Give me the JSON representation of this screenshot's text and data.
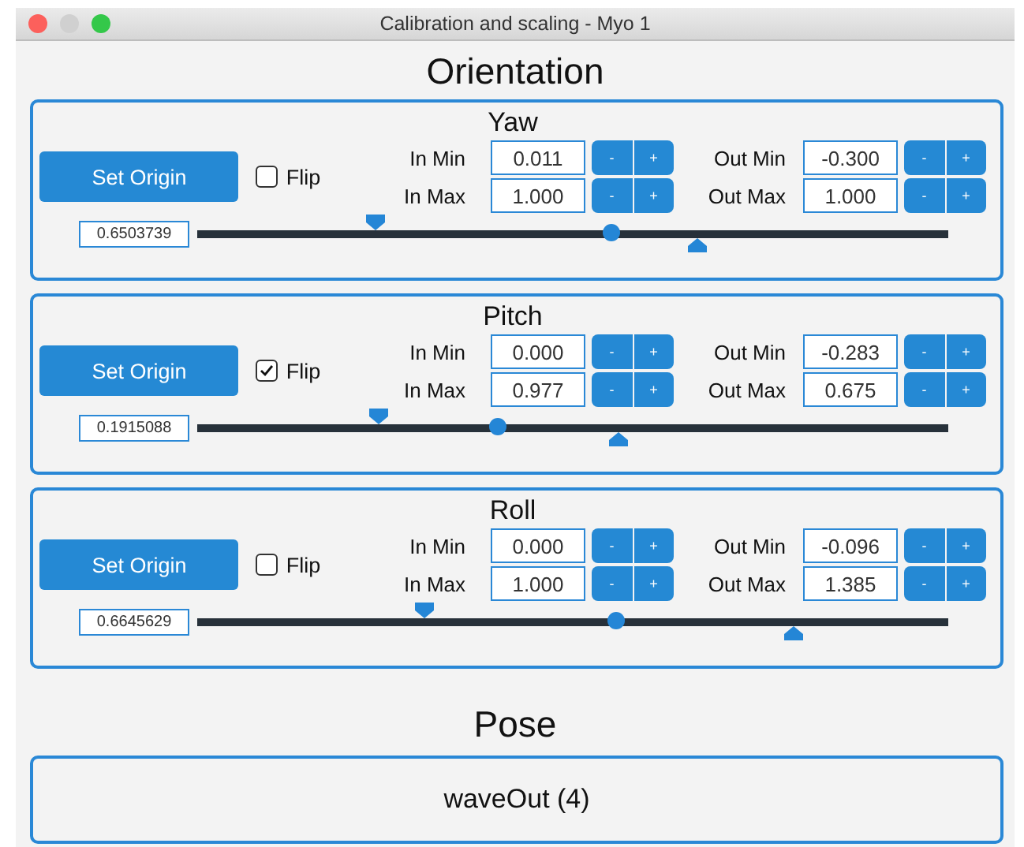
{
  "window": {
    "title": "Calibration and scaling - Myo 1"
  },
  "orientation": {
    "heading": "Orientation",
    "axes": [
      {
        "title": "Yaw",
        "button": "Set Origin",
        "flip": {
          "label": "Flip",
          "checked": false
        },
        "fields": [
          {
            "label": "In Min",
            "value": "0.011",
            "minus": "-",
            "plus": "+"
          },
          {
            "label": "Out Min",
            "value": "-0.300",
            "minus": "-",
            "plus": "+"
          },
          {
            "label": "In Max",
            "value": "1.000",
            "minus": "-",
            "plus": "+"
          },
          {
            "label": "Out Max",
            "value": "1.000",
            "minus": "-",
            "plus": "+"
          }
        ],
        "reading": "0.6503739",
        "markers": [
          {
            "kind": "low",
            "level": 0.238
          },
          {
            "kind": "value",
            "level": 0.55
          },
          {
            "kind": "high",
            "level": 0.665
          }
        ]
      },
      {
        "title": "Pitch",
        "button": "Set Origin",
        "flip": {
          "label": "Flip",
          "checked": true
        },
        "fields": [
          {
            "label": "In Min",
            "value": "0.000",
            "minus": "-",
            "plus": "+"
          },
          {
            "label": "Out Min",
            "value": "-0.283",
            "minus": "-",
            "plus": "+"
          },
          {
            "label": "In Max",
            "value": "0.977",
            "minus": "-",
            "plus": "+"
          },
          {
            "label": "Out Max",
            "value": "0.675",
            "minus": "-",
            "plus": "+"
          }
        ],
        "reading": "0.1915088",
        "markers": [
          {
            "kind": "low",
            "level": 0.242
          },
          {
            "kind": "value",
            "level": 0.4
          },
          {
            "kind": "high",
            "level": 0.56
          }
        ]
      },
      {
        "title": "Roll",
        "button": "Set Origin",
        "flip": {
          "label": "Flip",
          "checked": false
        },
        "fields": [
          {
            "label": "In Min",
            "value": "0.000",
            "minus": "-",
            "plus": "+"
          },
          {
            "label": "Out Min",
            "value": "-0.096",
            "minus": "-",
            "plus": "+"
          },
          {
            "label": "In Max",
            "value": "1.000",
            "minus": "-",
            "plus": "+"
          },
          {
            "label": "Out Max",
            "value": "1.385",
            "minus": "-",
            "plus": "+"
          }
        ],
        "reading": "0.6645629",
        "markers": [
          {
            "kind": "low",
            "level": 0.303
          },
          {
            "kind": "value",
            "level": 0.556
          },
          {
            "kind": "high",
            "level": 0.794
          }
        ]
      }
    ]
  },
  "pose": {
    "heading": "Pose",
    "value": "waveOut (4)"
  }
}
